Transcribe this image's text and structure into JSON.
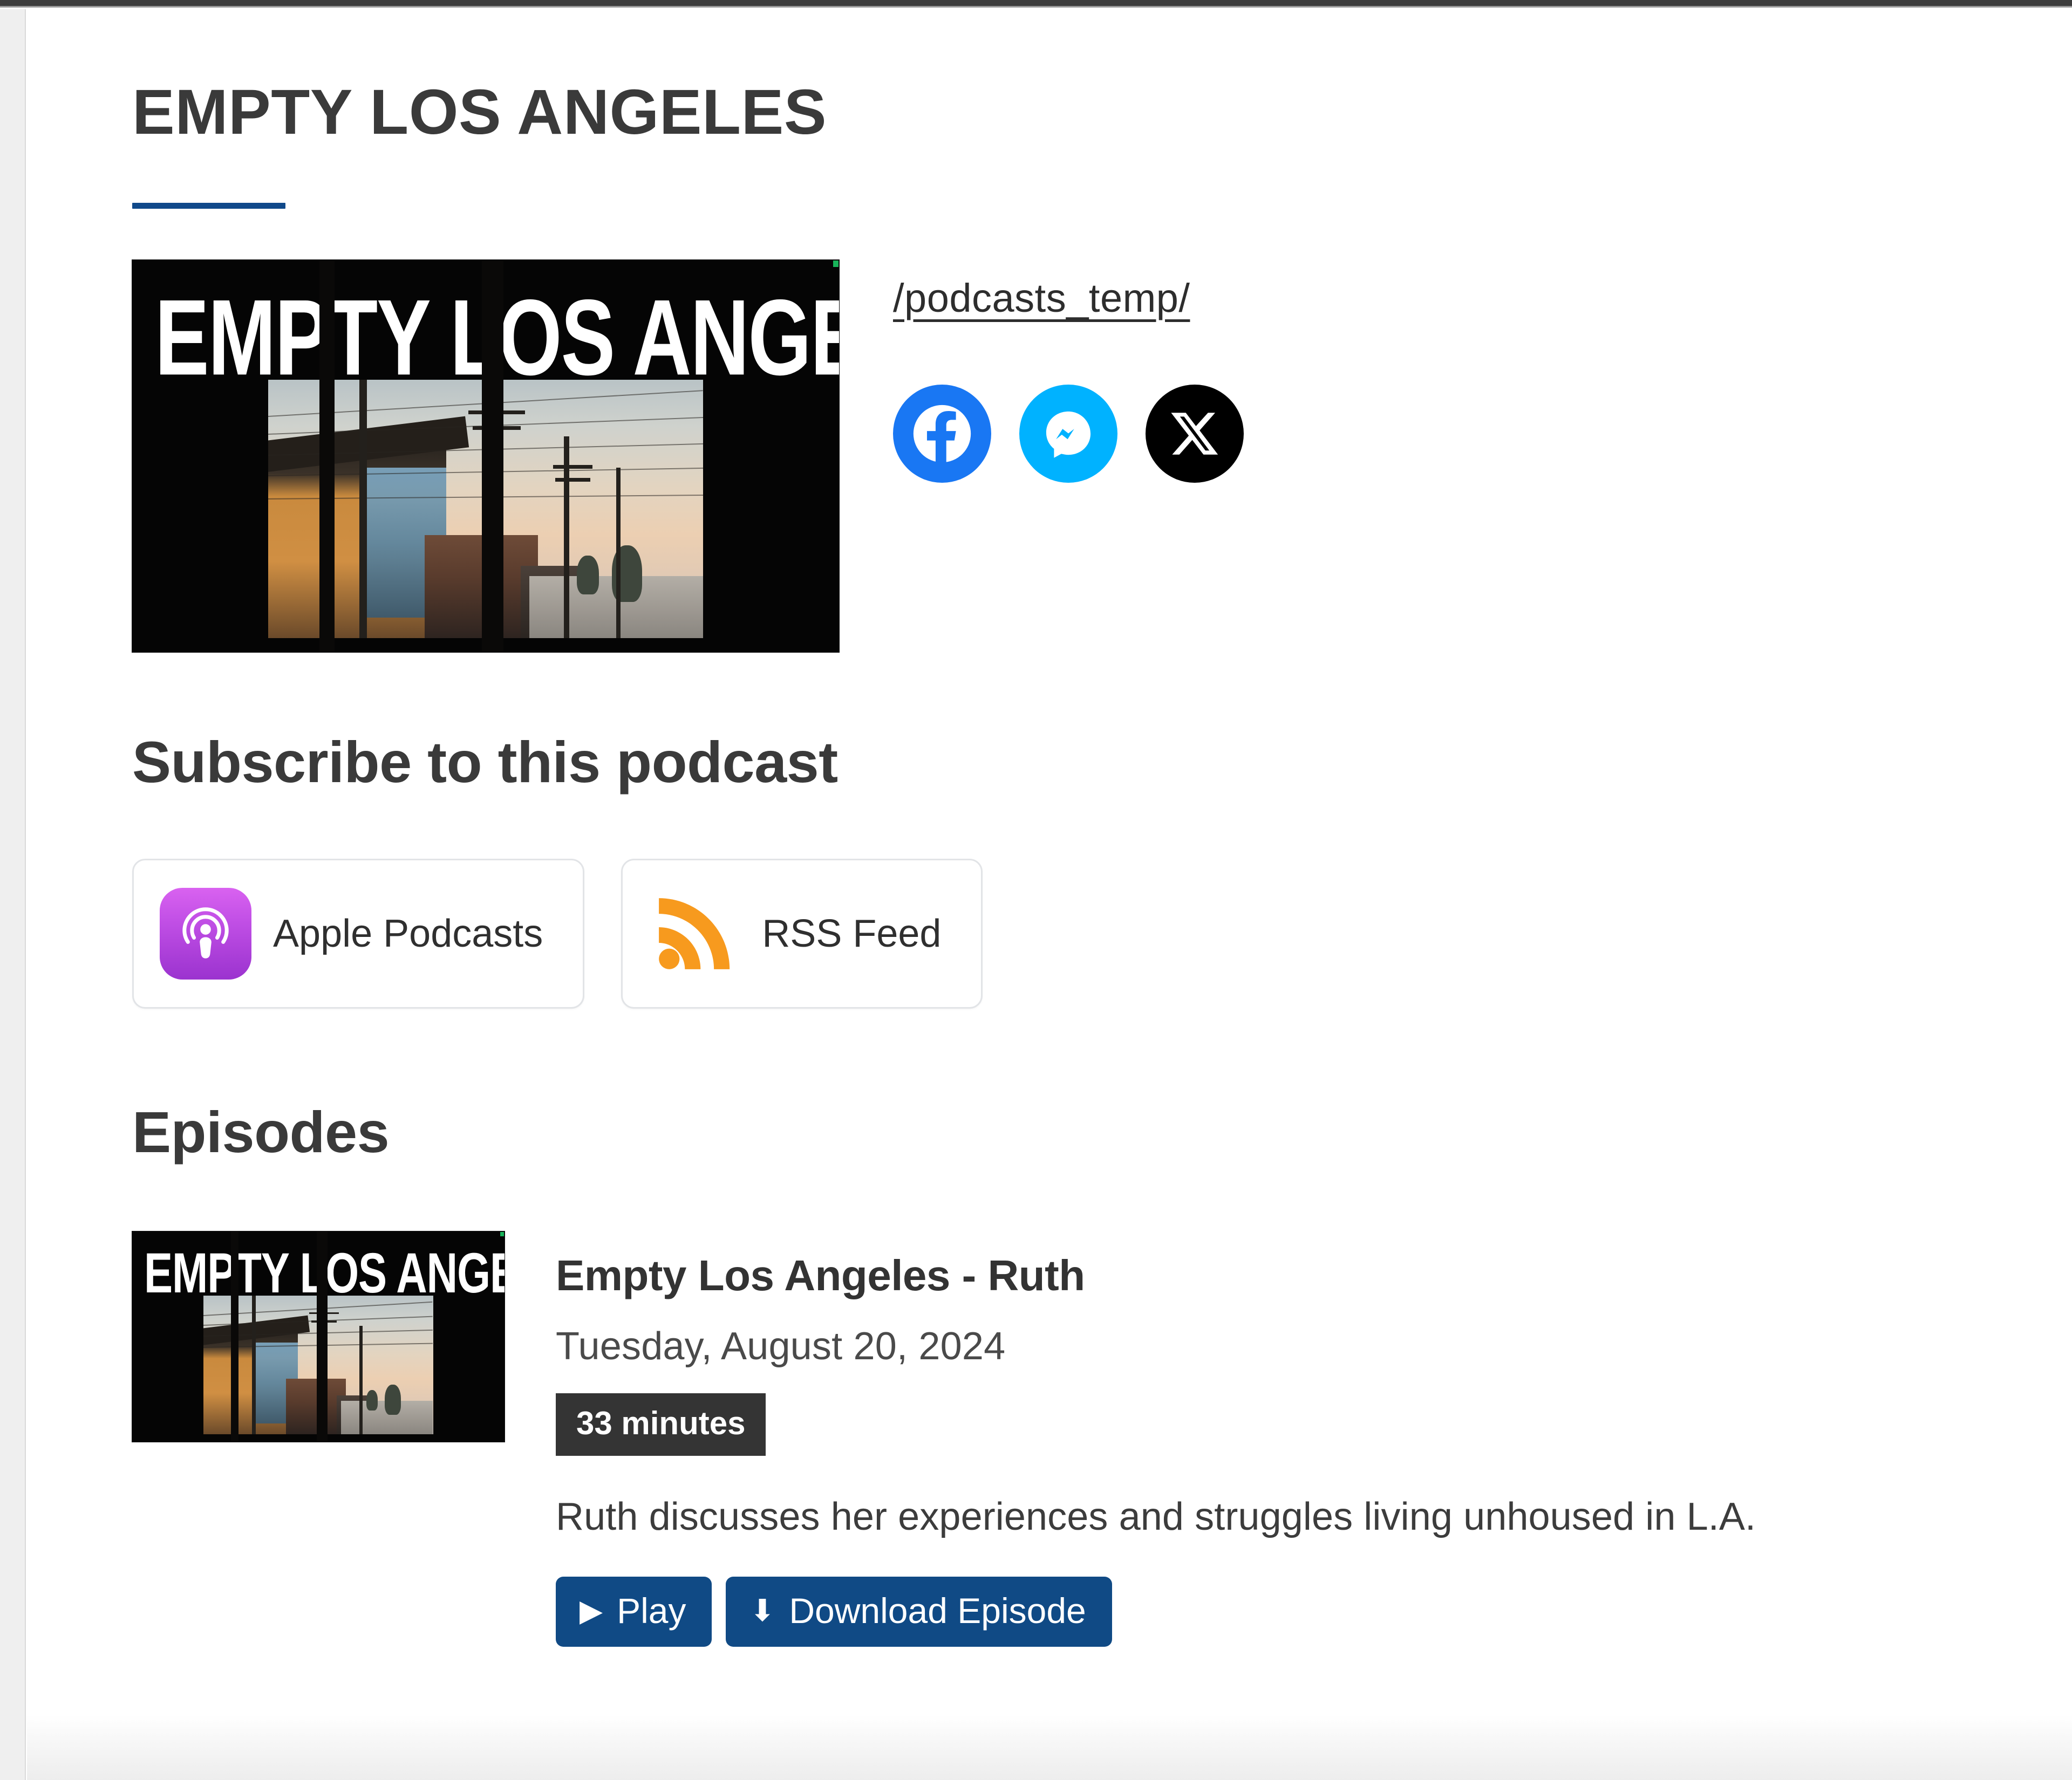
{
  "page": {
    "title": "EMPTY LOS ANGELES",
    "accent_color": "#10498a",
    "heading_color": "#3a3a3a"
  },
  "hero": {
    "cover_alt_title": "EMPTY LOS ANGELES",
    "feed_link": "/podcasts_temp/",
    "social": [
      {
        "name": "facebook",
        "label": "Facebook",
        "color": "#1977f3"
      },
      {
        "name": "messenger",
        "label": "Messenger",
        "color": "#00b2ff"
      },
      {
        "name": "x",
        "label": "X",
        "color": "#000000"
      }
    ]
  },
  "subscribe": {
    "heading": "Subscribe to this podcast",
    "options": [
      {
        "label": "Apple Podcasts",
        "icon": "apple-podcasts-icon",
        "color": "#a42fd4"
      },
      {
        "label": "RSS Feed",
        "icon": "rss-icon",
        "color": "#f79a1e"
      }
    ]
  },
  "episodes_section": {
    "heading": "Episodes",
    "items": [
      {
        "thumb_title": "EMPTY LOS ANGELES",
        "title": "Empty Los Angeles - Ruth",
        "date": "Tuesday, August 20, 2024",
        "duration": "33 minutes",
        "description": "Ruth discusses her experiences and struggles living unhoused in L.A.",
        "play_label": "Play",
        "download_label": "Download Episode",
        "button_color": "#104a85"
      }
    ]
  }
}
